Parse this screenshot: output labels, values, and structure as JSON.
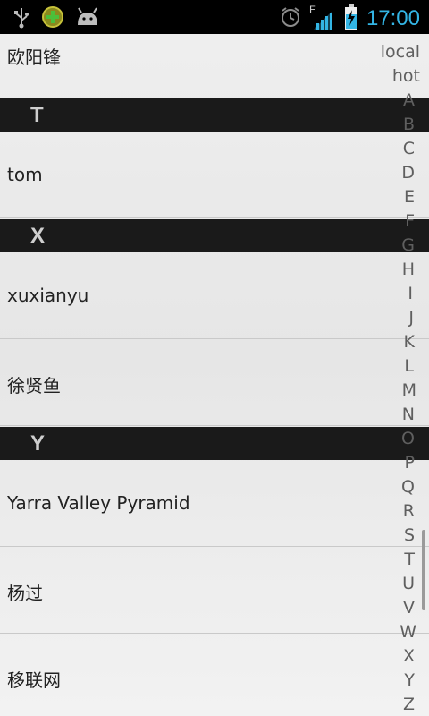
{
  "status_bar": {
    "time": "17:00",
    "network_label": "E",
    "left_icons": [
      "usb-icon",
      "app-badge-icon",
      "android-icon"
    ],
    "right_icons": [
      "alarm-icon",
      "signal-icon",
      "battery-charging-icon"
    ],
    "accent_color": "#33b5e5"
  },
  "list": {
    "rows": [
      {
        "type": "item",
        "label": "欧阳锋"
      },
      {
        "type": "header",
        "label": "T"
      },
      {
        "type": "item",
        "label": "tom"
      },
      {
        "type": "header",
        "label": "X"
      },
      {
        "type": "item",
        "label": "xuxianyu"
      },
      {
        "type": "item",
        "label": "徐贤鱼"
      },
      {
        "type": "header",
        "label": "Y"
      },
      {
        "type": "item",
        "label": "Yarra Valley Pyramid"
      },
      {
        "type": "item",
        "label": "杨过"
      },
      {
        "type": "item",
        "label": "移联网"
      }
    ]
  },
  "index_bar": {
    "letters": [
      "local",
      "hot",
      "A",
      "B",
      "C",
      "D",
      "E",
      "F",
      "G",
      "H",
      "I",
      "J",
      "K",
      "L",
      "M",
      "N",
      "O",
      "P",
      "Q",
      "R",
      "S",
      "T",
      "U",
      "V",
      "W",
      "X",
      "Y",
      "Z"
    ]
  }
}
